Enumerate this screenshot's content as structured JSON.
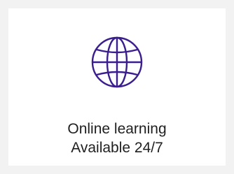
{
  "colors": {
    "background": "#f2f2f2",
    "card": "#ffffff",
    "icon": "#3b1e8e",
    "text": "#1f1f1f"
  },
  "icon": {
    "name": "globe-icon"
  },
  "feature": {
    "title": "Online learning",
    "subtitle": "Available 24/7"
  }
}
